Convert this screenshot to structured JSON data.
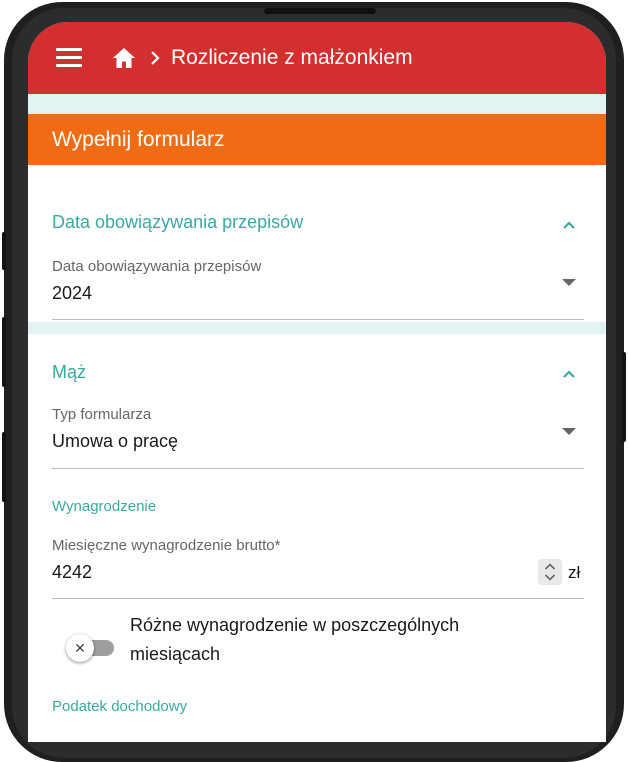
{
  "header": {
    "title": "Rozliczenie z małżonkiem",
    "menu_icon": "menu-icon",
    "home_icon": "home-icon",
    "breadcrumb_separator_icon": "chevron-right-icon",
    "background_color": "#d32f2f"
  },
  "form_banner": {
    "label": "Wypełnij formularz",
    "background_color": "#ef6c14"
  },
  "section_regulations": {
    "title": "Data obowiązywania przepisów",
    "field": {
      "label": "Data obowiązywania przepisów",
      "value": "2024"
    }
  },
  "section_husband": {
    "title": "Mąż",
    "form_type": {
      "label": "Typ formularza",
      "value": "Umowa o pracę"
    },
    "salary_heading": "Wynagrodzenie",
    "monthly_salary": {
      "label": "Miesięczne wynagrodzenie brutto*",
      "value": "4242",
      "currency": "zł"
    },
    "different_salary_toggle": {
      "label": "Różne wynagrodzenie w poszczególnych miesiącach",
      "enabled": false
    },
    "income_tax_heading": "Podatek dochodowy"
  },
  "accent_color": "#3aa99f"
}
